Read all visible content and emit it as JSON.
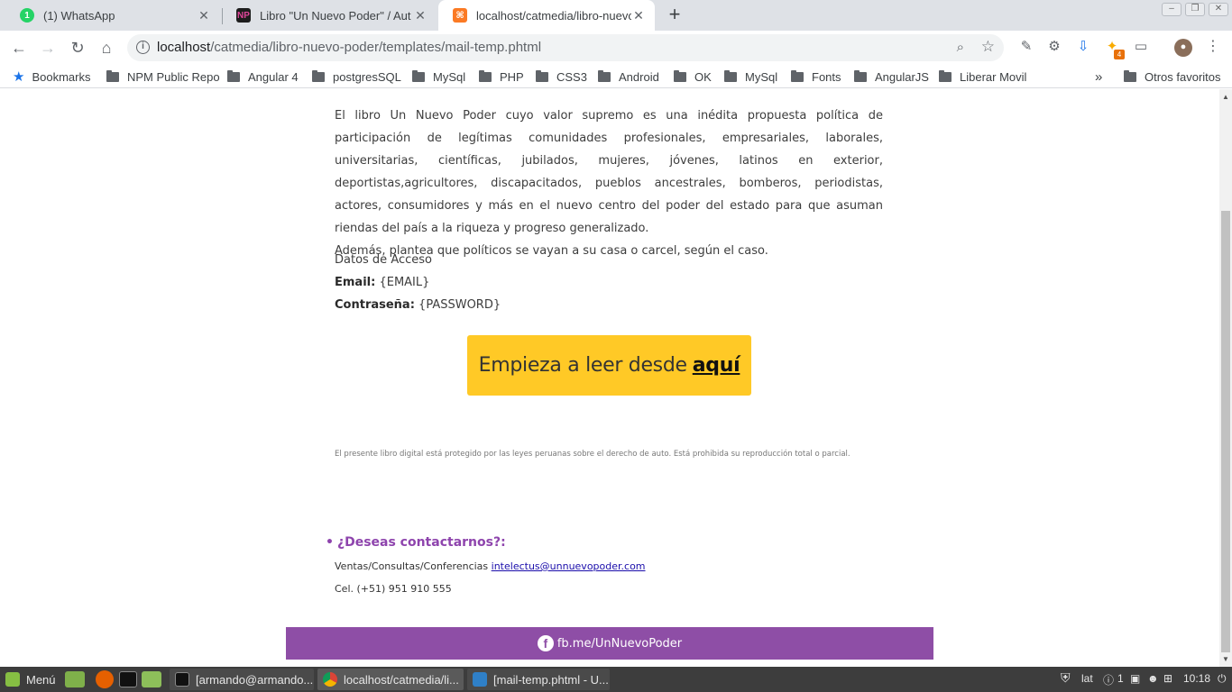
{
  "tabs": [
    {
      "title": "(1) WhatsApp",
      "favicon": "whatsapp-icon",
      "favicon_text": "1",
      "color": "#25d366"
    },
    {
      "title": "Libro \"Un Nuevo Poder\" / Autor",
      "favicon": "np-logo-icon",
      "favicon_text": "NP",
      "color": "#1d1d1d"
    },
    {
      "title": "localhost/catmedia/libro-nuevo-",
      "favicon": "xampp-icon",
      "favicon_text": "⌘",
      "color": "#fb7a24"
    }
  ],
  "address": {
    "host": "localhost",
    "path": "/catmedia/libro-nuevo-poder/templates/mail-temp.phtml"
  },
  "bookmarks": {
    "star_label": "Bookmarks",
    "items": [
      "NPM Public Repo",
      "Angular 4",
      "postgresSQL",
      "MySql",
      "PHP",
      "CSS3",
      "Android",
      "OK",
      "MySql",
      "Fonts",
      "AngularJS",
      "Liberar Movil"
    ],
    "overflow": "»",
    "other": "Otros favoritos"
  },
  "extensions": {
    "badge": "4"
  },
  "page": {
    "intro": "El libro Un Nuevo Poder cuyo valor supremo es una inédita propuesta política de participación de legítimas comunidades profesionales, empresariales, laborales, universitarias, científicas, jubilados, mujeres, jóvenes, latinos en exterior, deportistas,agricultores, discapacitados, pueblos ancestrales, bomberos, periodistas, actores, consumidores y más en el nuevo centro del poder del estado para que asuman riendas del país a la riqueza y progreso generalizado.",
    "intro2": "Además, plantea que políticos se vayan a su casa o carcel, según el caso.",
    "access_title": "Datos de Acceso",
    "email_label": "Email:",
    "email_value": "{EMAIL}",
    "password_label": "Contraseña:",
    "password_value": "{PASSWORD}",
    "cta_text": "Empieza a leer desde",
    "cta_link": "aquí",
    "legal": "El presente libro digital está protegido por las leyes peruanas sobre el derecho de auto. Está prohibida su reproducción total o parcial.",
    "contact_title": "¿Deseas contactarnos?:",
    "contact_label": "Ventas/Consultas/Conferencias",
    "contact_email": "intelectus@unnuevopoder.com",
    "phone": "Cel. (+51) 951 910 555",
    "fb_link": "fb.me/UnNuevoPoder"
  },
  "taskbar": {
    "menu_label": "Menú",
    "windows": [
      {
        "title": "[armando@armando..."
      },
      {
        "title": "localhost/catmedia/li..."
      },
      {
        "title": "[mail-temp.phtml - U..."
      }
    ],
    "keyboard": "lat",
    "notif_count": "1",
    "clock": "10:18"
  },
  "colors": {
    "accent": "#8e4ea6",
    "cta": "#ffc926"
  }
}
